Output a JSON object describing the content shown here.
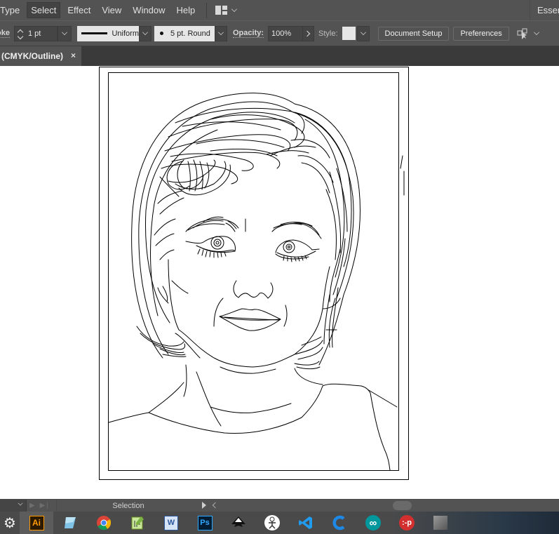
{
  "menubar": {
    "items": [
      {
        "label": "Type",
        "active": false
      },
      {
        "label": "Select",
        "active": true
      },
      {
        "label": "Effect",
        "active": false
      },
      {
        "label": "View",
        "active": false
      },
      {
        "label": "Window",
        "active": false
      },
      {
        "label": "Help",
        "active": false
      }
    ],
    "workspace_icon": "workspace-layout-icon",
    "workspace_label": "Essentials"
  },
  "controlbar": {
    "stroke_label": "Stroke:",
    "stroke_value": "1 pt",
    "variable_width_profile": "Uniform",
    "brush_definition": "5 pt. Round",
    "opacity_label": "Opacity:",
    "opacity_value": "100%",
    "style_label": "Style:",
    "style_swatch_color": "#e6e6e6",
    "document_setup_label": "Document Setup",
    "preferences_label": "Preferences",
    "arrange_icon": "select-similar-objects-icon"
  },
  "tabs": [
    {
      "label": "(CMYK/Outline)",
      "close_icon": "×"
    }
  ],
  "canvas": {
    "view_mode": "Outline",
    "artwork": "line-art portrait of a woman with short wavy hair"
  },
  "statusbar": {
    "tool_label": "Selection"
  },
  "taskbar": {
    "items": [
      {
        "name": "settings",
        "icon": "gear-icon",
        "active": false
      },
      {
        "name": "Adobe Illustrator",
        "icon": "illustrator-icon",
        "label": "Ai",
        "active": true
      },
      {
        "name": "Notepad",
        "icon": "notepad-icon",
        "active": false
      },
      {
        "name": "Google Chrome",
        "icon": "chrome-icon",
        "active": false
      },
      {
        "name": "Notepad++",
        "icon": "notepadpp-icon",
        "active": false
      },
      {
        "name": "Microsoft Word",
        "icon": "word-icon",
        "label": "W",
        "active": false
      },
      {
        "name": "Adobe Photoshop",
        "icon": "photoshop-icon",
        "label": "Ps",
        "active": false
      },
      {
        "name": "Inkscape",
        "icon": "inkscape-icon",
        "active": false
      },
      {
        "name": "Processing",
        "icon": "processing-icon",
        "active": false
      },
      {
        "name": "Visual Studio Code",
        "icon": "vscode-icon",
        "active": false
      },
      {
        "name": "CCleaner",
        "icon": "ccleaner-icon",
        "active": false
      },
      {
        "name": "Arduino",
        "icon": "arduino-icon",
        "label": "∞",
        "active": false
      },
      {
        "name": "Pidgin",
        "icon": "pidgin-icon",
        "label": ":-p",
        "active": false
      },
      {
        "name": "App",
        "icon": "generic-app-icon",
        "active": false
      }
    ]
  },
  "colors": {
    "chrome_bg": "#535353",
    "tab_row_bg": "#3a3a3a",
    "canvas_bg": "#ffffff",
    "outline_stroke": "#000000"
  }
}
